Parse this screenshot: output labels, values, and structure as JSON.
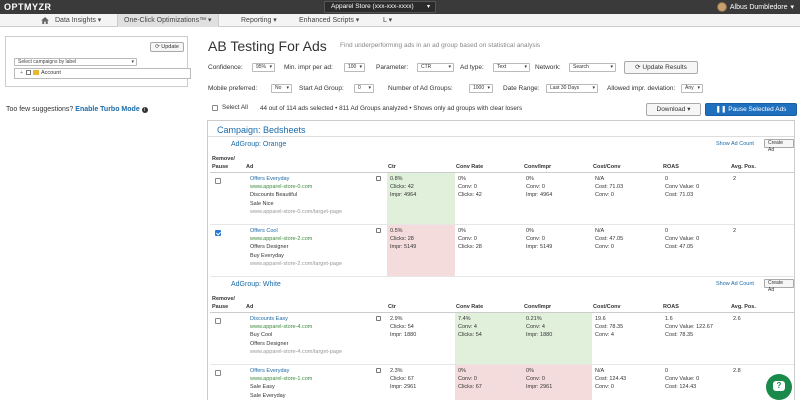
{
  "app": {
    "logo": "OPTMYZR"
  },
  "account": {
    "selected": "Apparel Store (xxx-xxx-xxxx)",
    "caret": "▾"
  },
  "user": {
    "name": "Albus Dumbledore",
    "caret": "▾"
  },
  "nav": {
    "items": [
      {
        "label": "Data Insights ▾"
      },
      {
        "label": "One-Click Optimizations™ ▾"
      },
      {
        "label": "Reporting ▾"
      },
      {
        "label": "Enhanced Scripts ▾"
      },
      {
        "label": "L ▾"
      }
    ]
  },
  "left": {
    "update_label": "Update",
    "label_select": "Select campaigns by label",
    "tree_item": "Account",
    "turbo_prefix": "Too few suggestions?",
    "turbo_link": "Enable Turbo Mode"
  },
  "page": {
    "title": "AB Testing For Ads",
    "subtitle": "Find underperforming ads in an ad group based on statistical analysis"
  },
  "filters": {
    "confidence_label": "Confidence:",
    "confidence_value": "95%",
    "min_impr_label": "Min. impr per ad:",
    "min_impr_value": "100",
    "parameter_label": "Parameter:",
    "parameter_value": "CTR",
    "adtype_label": "Ad type:",
    "adtype_value": "Text",
    "network_label": "Network:",
    "network_value": "Search",
    "update_results": "Update Results",
    "mobile_label": "Mobile preferred:",
    "mobile_value": "No",
    "start_label": "Start Ad Group:",
    "start_value": "0",
    "num_label": "Number of Ad Groups:",
    "num_value": "1000",
    "date_label": "Date Range:",
    "date_value": "Last 30 Days",
    "dev_label": "Allowed impr. deviation:",
    "dev_value": "Any"
  },
  "actions": {
    "select_all": "Select All",
    "summary": "44 out of 114 ads selected • 811 Ad Groups analyzed • Shows only ad groups with clear losers",
    "download": "Download ▾",
    "pause": "Pause Selected Ads"
  },
  "campaign": {
    "title": "Campaign: Bedsheets",
    "show_count": "Show Ad Count",
    "create_ad": "Create Ad",
    "columns": [
      "Remove/",
      "Pause",
      "Ad",
      "Ctr",
      "Conv Rate",
      "Conv/Impr",
      "Cost/Conv",
      "ROAS",
      "Avg. Pos."
    ],
    "adgroups": [
      {
        "title": "AdGroup: Orange",
        "rows": [
          {
            "checked": false,
            "headline": "Offers Everyday",
            "url": "www.apparel-store-0.com",
            "line1": "Discounts Beautiful",
            "line2": "Sale Nice",
            "final_url": "www.apparel-store-0.com/target-page",
            "ctr": "0.8%",
            "ctr_clicks": "Clicks: 42",
            "ctr_impr": "Impr: 4964",
            "ctr_state": "good",
            "conv_rate": "0%",
            "conv_rate_conv": "Conv: 0",
            "conv_rate_clicks": "Clicks: 42",
            "conv_impr": "0%",
            "conv_impr_conv": "Conv: 0",
            "conv_impr_impr": "Impr: 4964",
            "cost_conv": "N/A",
            "cost_conv_cost": "Cost: 71.03",
            "cost_conv_conv": "Conv: 0",
            "roas": "0",
            "roas_value": "Conv Value: 0",
            "roas_cost": "Cost: 71.03",
            "avg_pos": "2"
          },
          {
            "checked": true,
            "headline": "Offers Cool",
            "url": "www.apparel-store-2.com",
            "line1": "Offers Designer",
            "line2": "Buy Everyday",
            "final_url": "www.apparel-store-2.com/target-page",
            "ctr": "0.5%",
            "ctr_clicks": "Clicks: 28",
            "ctr_impr": "Impr: 5149",
            "ctr_state": "bad",
            "conv_rate": "0%",
            "conv_rate_conv": "Conv: 0",
            "conv_rate_clicks": "Clicks: 28",
            "conv_impr": "0%",
            "conv_impr_conv": "Conv: 0",
            "conv_impr_impr": "Impr: 5149",
            "cost_conv": "N/A",
            "cost_conv_cost": "Cost: 47.05",
            "cost_conv_conv": "Conv: 0",
            "roas": "0",
            "roas_value": "Conv Value: 0",
            "roas_cost": "Cost: 47.05",
            "avg_pos": "2"
          }
        ]
      },
      {
        "title": "AdGroup: White",
        "rows": [
          {
            "checked": false,
            "headline": "Discounts Easy",
            "url": "www.apparel-store-4.com",
            "line1": "Buy Cool",
            "line2": "Offers Designer",
            "final_url": "www.apparel-store-4.com/target-page",
            "ctr": "2.9%",
            "ctr_clicks": "Clicks: 54",
            "ctr_impr": "Impr: 1880",
            "conv_rate": "7.4%",
            "conv_rate_conv": "Conv: 4",
            "conv_rate_clicks": "Clicks: 54",
            "conv_state": "good",
            "conv_impr": "0.21%",
            "conv_impr_conv": "Conv: 4",
            "conv_impr_impr": "Impr: 1880",
            "cost_conv": "19.6",
            "cost_conv_cost": "Cost: 78.35",
            "cost_conv_conv": "Conv: 4",
            "roas": "1.6",
            "roas_value": "Conv Value: 122.67",
            "roas_cost": "Cost: 78.35",
            "avg_pos": "2.6"
          },
          {
            "checked": false,
            "headline": "Offers Everyday",
            "url": "www.apparel-store-1.com",
            "line1": "Sale Easy",
            "line2": "Sale Everyday",
            "final_url": "",
            "ctr": "2.3%",
            "ctr_clicks": "Clicks: 67",
            "ctr_impr": "Impr: 2961",
            "conv_rate": "0%",
            "conv_rate_conv": "Conv: 0",
            "conv_rate_clicks": "Clicks: 67",
            "conv_state": "bad",
            "conv_impr": "0%",
            "conv_impr_conv": "Conv: 0",
            "conv_impr_impr": "Impr: 2961",
            "cost_conv": "N/A",
            "cost_conv_cost": "Cost: 124.43",
            "cost_conv_conv": "Conv: 0",
            "roas": "0",
            "roas_value": "Conv Value: 0",
            "roas_cost": "Cost: 124.43",
            "avg_pos": "2.8"
          }
        ]
      }
    ]
  }
}
